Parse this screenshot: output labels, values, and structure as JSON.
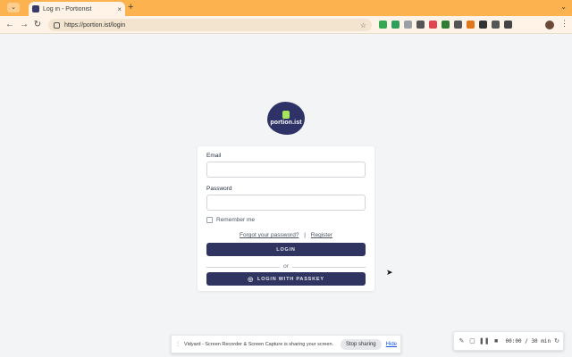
{
  "browser": {
    "tab_title": "Log in - Portionist",
    "tab_close": "×",
    "new_tab": "+",
    "url": "https://portion.ist/login",
    "window_caret": "⌄",
    "window_menu": "⌄",
    "icons": {
      "back": "←",
      "forward": "→",
      "reload": "↻",
      "bookmark": "☆",
      "menu": "⋮"
    },
    "extensions": [
      {
        "name": "drive-ext-icon",
        "color": "#34a853"
      },
      {
        "name": "sheets-ext-icon",
        "color": "#2e9e5b"
      },
      {
        "name": "mail-ext-icon",
        "color": "#9aa0a6"
      },
      {
        "name": "bookmark-ext-icon",
        "color": "#555555"
      },
      {
        "name": "pocket-ext-icon",
        "color": "#e0464f"
      },
      {
        "name": "check-ext-icon",
        "color": "#2e7d32"
      },
      {
        "name": "note-ext-icon",
        "color": "#555555"
      },
      {
        "name": "fox-ext-icon",
        "color": "#e2761b"
      },
      {
        "name": "record-ext-icon",
        "color": "#333333"
      },
      {
        "name": "grid-ext-icon",
        "color": "#555555"
      },
      {
        "name": "puzzle-ext-icon",
        "color": "#444444"
      }
    ]
  },
  "logo": {
    "text": "portion.ist",
    "bg_color": "#2f3266",
    "accent_color": "#a7e35b"
  },
  "form": {
    "email_label": "Email",
    "email_value": "",
    "password_label": "Password",
    "password_value": "",
    "remember_label": "Remember me",
    "forgot_link": "Forgot your password?",
    "separator": "|",
    "register_link": "Register",
    "login_button": "LOGIN",
    "or_text": "or",
    "passkey_icon": "◎",
    "passkey_button": "LOGIN WITH PASSKEY",
    "button_color": "#2f3461"
  },
  "share_bar": {
    "grip": "⋮",
    "message": "Vidyard - Screen Recorder & Screen Capture is sharing your screen.",
    "stop_button": "Stop sharing",
    "hide_link": "Hide"
  },
  "recorder": {
    "pen_icon": "✎",
    "draw_icon": "▢",
    "pause_icon": "❚❚",
    "stop_icon": "■",
    "timer": "00:00 / 30 min",
    "restart_icon": "↻"
  }
}
